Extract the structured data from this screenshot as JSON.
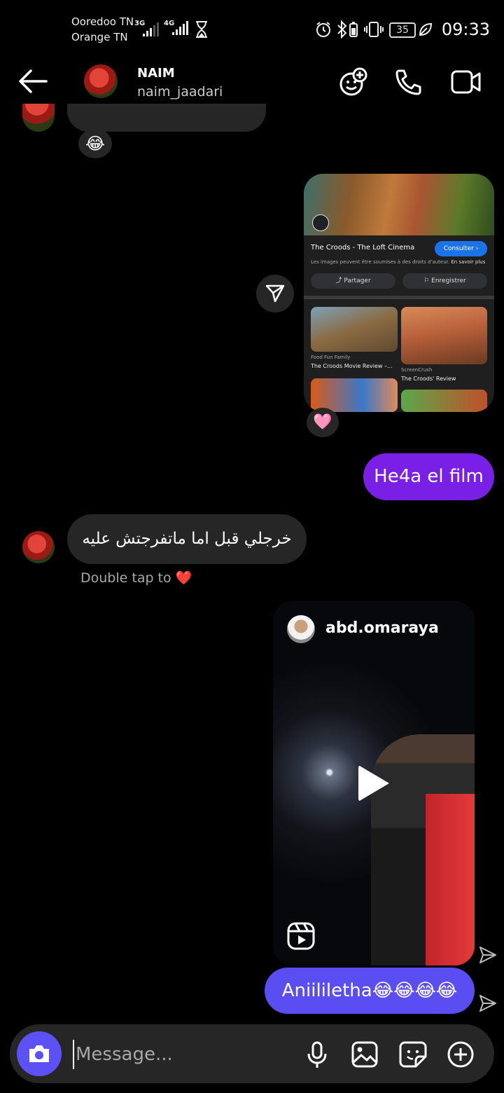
{
  "status_bar": {
    "carrier1": "Ooredoo TN",
    "carrier2": "Orange TN",
    "net1": "3G",
    "net2": "4G",
    "battery": "35",
    "time": "09:33"
  },
  "header": {
    "name": "NAIM",
    "username": "naim_jaadari"
  },
  "messages": {
    "reaction_laugh": "😂",
    "shared_card": {
      "title": "The Croods - The Loft Cinema",
      "consult": "Consulter ›",
      "note": "Les images peuvent être soumises à des droits d'auteur.",
      "note_link": "En savoir plus",
      "share": "Partager",
      "save": "Enregistrer",
      "t1_source": "Food Fun Family",
      "t1_caption": "The Croods Movie Review –...",
      "t2_source": "ScreenCrush",
      "t2_caption": "The Croods' Review",
      "reaction": "🩷"
    },
    "msg_sent_1": "He4a el film",
    "msg_received_1": "خرجلي قبل اما ماتفرجتش عليه",
    "double_tap": "Double tap to",
    "heart": "❤️",
    "reel": {
      "username": "abd.omaraya"
    },
    "msg_sent_2": "Aniililetha😂😂😂😂"
  },
  "composer": {
    "placeholder": "Message..."
  },
  "colors": {
    "purple_bubble": "#7a1fe6",
    "blue_bubble": "#5a4df2",
    "camera_button": "#5b51f5"
  }
}
